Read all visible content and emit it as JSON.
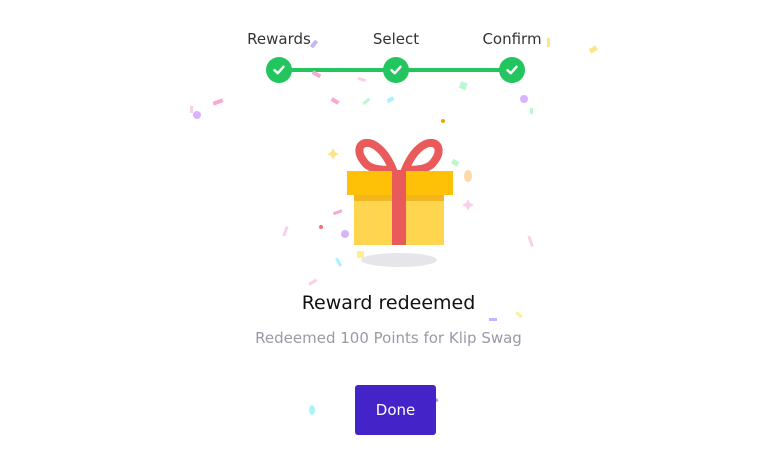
{
  "stepper": {
    "steps": [
      {
        "label": "Rewards",
        "state": "complete"
      },
      {
        "label": "Select",
        "state": "complete"
      },
      {
        "label": "Confirm",
        "state": "complete"
      }
    ],
    "check_icon": "check-icon"
  },
  "result": {
    "illustration": "gift-icon",
    "title": "Reward redeemed",
    "subtitle": "Redeemed 100 Points for Klip Swag"
  },
  "actions": {
    "done_label": "Done"
  },
  "colors": {
    "success": "#22c55e",
    "primary_button": "#4424c9",
    "gift_box": "#ffd44f",
    "gift_lid": "#ffc107",
    "gift_ribbon": "#e95a5a",
    "muted_text": "#9a9aa6"
  }
}
